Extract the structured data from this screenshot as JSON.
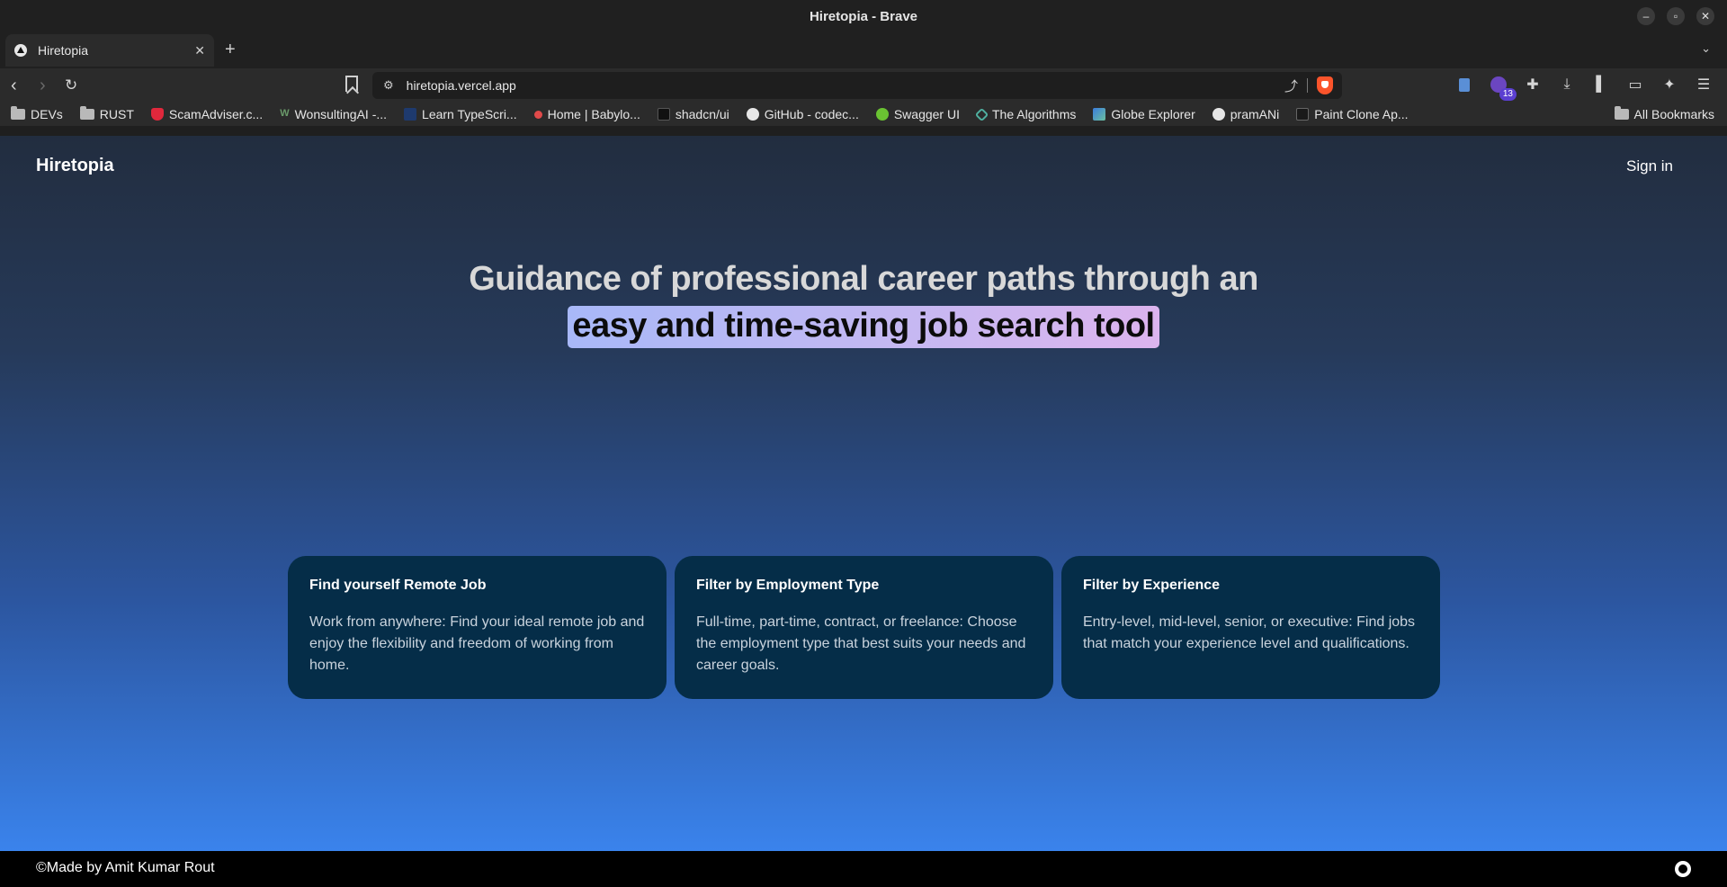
{
  "window": {
    "title": "Hiretopia - Brave"
  },
  "tabs": [
    {
      "title": "Hiretopia"
    }
  ],
  "address_bar": {
    "url": "hiretopia.vercel.app"
  },
  "extensions": {
    "badge_count": "13"
  },
  "bookmarks": {
    "items": [
      {
        "label": "DEVs",
        "icon": "folder-icon"
      },
      {
        "label": "RUST",
        "icon": "folder-icon"
      },
      {
        "label": "ScamAdviser.c...",
        "icon": "shield-icon",
        "color": "#e0283c"
      },
      {
        "label": "WonsultingAI -...",
        "icon": "w-logo-icon",
        "color": "#6a9a6a"
      },
      {
        "label": "Learn TypeScri...",
        "icon": "ts-logo-icon",
        "color": "#1e3a6e"
      },
      {
        "label": "Home | Babylo...",
        "icon": "babylon-icon",
        "color": "#e04a4a"
      },
      {
        "label": "shadcn/ui",
        "icon": "shadcn-icon",
        "color": "#111111"
      },
      {
        "label": "GitHub - codec...",
        "icon": "github-icon",
        "color": "#e6e6e6"
      },
      {
        "label": "Swagger UI",
        "icon": "swagger-icon",
        "color": "#6ac332"
      },
      {
        "label": "The Algorithms",
        "icon": "algorithms-icon",
        "color": "#4fb0a0"
      },
      {
        "label": "Globe Explorer",
        "icon": "globe-icon",
        "color": "#3b7ddd"
      },
      {
        "label": "pramANi",
        "icon": "globe-icon",
        "color": "#e6e6e6"
      },
      {
        "label": "Paint Clone Ap...",
        "icon": "vercel-icon",
        "color": "#1a1a1a"
      }
    ],
    "all_label": "All Bookmarks"
  },
  "site": {
    "logo": "Hiretopia",
    "signin": "Sign in",
    "hero": {
      "line1": "Guidance of professional career paths through an",
      "line2": "easy and time-saving job search tool"
    },
    "cards": [
      {
        "title": "Find yourself Remote Job",
        "desc": "Work from anywhere: Find your ideal remote job and enjoy the flexibility and freedom of working from home."
      },
      {
        "title": "Filter by Employment Type",
        "desc": "Full-time, part-time, contract, or freelance: Choose the employment type that best suits your needs and career goals."
      },
      {
        "title": "Filter by Experience",
        "desc": "Entry-level, mid-level, senior, or executive: Find jobs that match your experience level and qualifications."
      }
    ],
    "footer": "©Made by Amit Kumar Rout"
  },
  "colors": {
    "page_gradient_top": "#222d3f",
    "page_gradient_bottom": "#3a83ec",
    "card_bg": "#052d48",
    "highlight_start": "#a8b8f8",
    "highlight_end": "#dcb4ee",
    "brave_orange": "#fb542b"
  }
}
